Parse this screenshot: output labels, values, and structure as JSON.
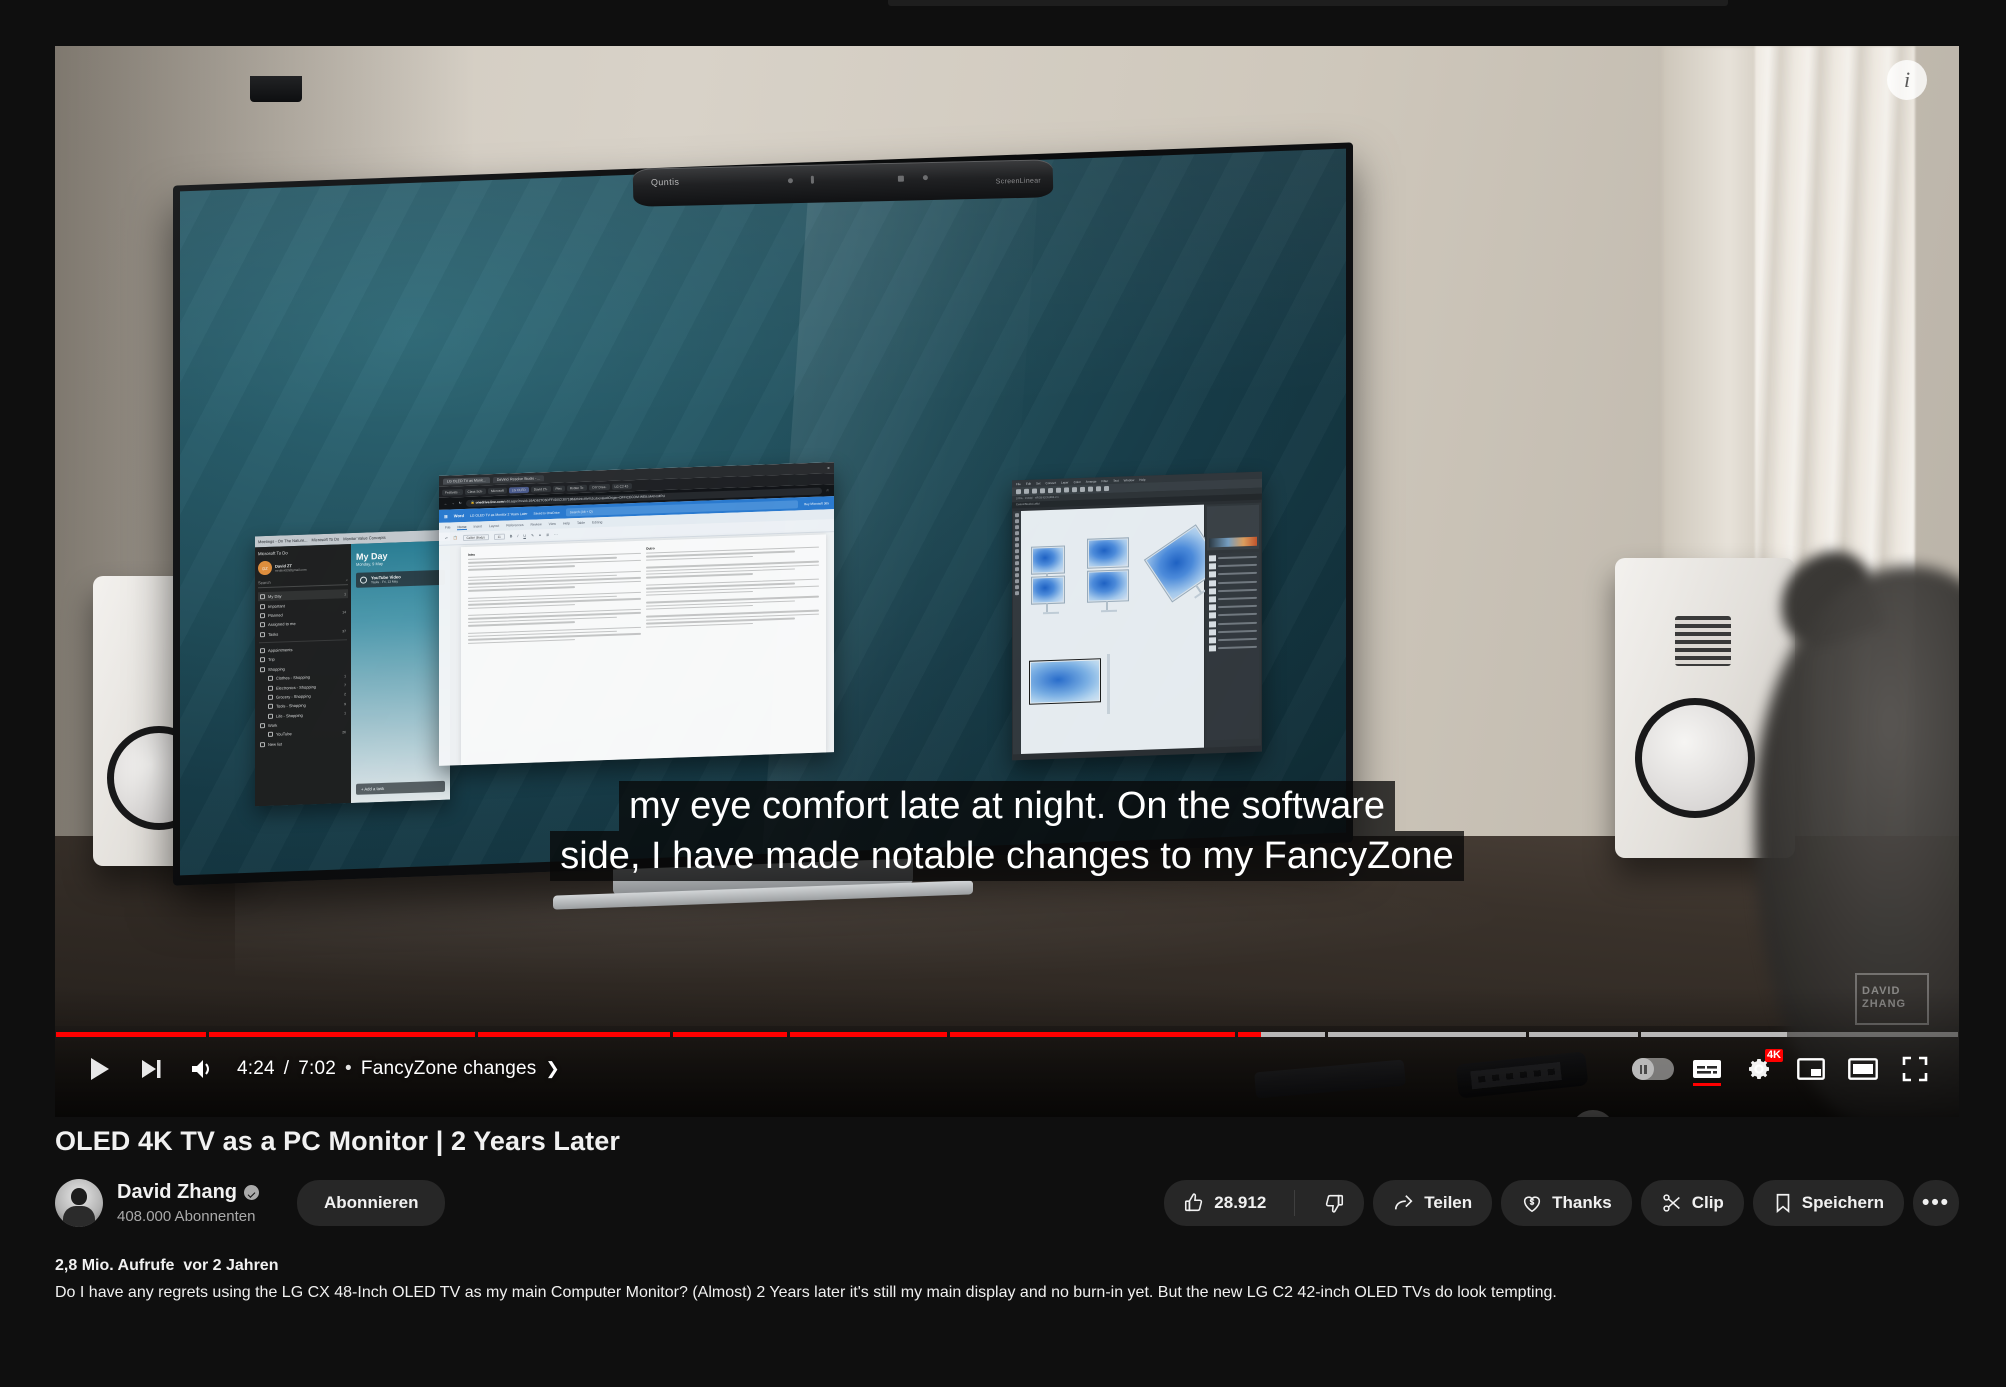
{
  "player": {
    "info_icon": "info-icon",
    "play_icon": "play-icon",
    "next_icon": "next-video-icon",
    "volume_icon": "volume-icon",
    "time_current": "4:24",
    "time_separator": "/",
    "time_total": "7:02",
    "chapter_bullet": "•",
    "chapter_name": "FancyZone changes",
    "chapter_chevron": "❯",
    "progress_percent": 62.8,
    "chapters": [
      {
        "width_pct": 8.0,
        "played_pct": 100
      },
      {
        "width_pct": 14.2,
        "played_pct": 100
      },
      {
        "width_pct": 10.2,
        "played_pct": 100
      },
      {
        "width_pct": 6.1,
        "played_pct": 100
      },
      {
        "width_pct": 8.4,
        "played_pct": 100
      },
      {
        "width_pct": 15.2,
        "played_pct": 100
      },
      {
        "width_pct": 4.6,
        "played_pct": 26,
        "loaded_pct": 100
      },
      {
        "width_pct": 10.6,
        "played_pct": 0,
        "loaded_pct": 100
      },
      {
        "width_pct": 5.8,
        "played_pct": 0,
        "loaded_pct": 100
      },
      {
        "width_pct": 16.9,
        "played_pct": 0,
        "loaded_pct": 46
      }
    ],
    "autoplay_toggle": {
      "state": "off",
      "knob_icon": "pause-icon"
    },
    "subtitles_icon": "subtitles-icon",
    "subtitles_active": true,
    "settings_icon": "gear-icon",
    "quality_badge": "4K",
    "miniplayer_icon": "miniplayer-icon",
    "theater_icon": "theater-mode-icon",
    "fullscreen_icon": "fullscreen-icon",
    "big_pause_icon": "pause-icon"
  },
  "captions": {
    "line1": "my eye comfort late at night. On the software",
    "line2": "side, I have made notable changes to my FancyZone"
  },
  "video": {
    "title": "OLED 4K TV as a PC Monitor | 2 Years Later",
    "watermark_line1": "DAVID",
    "watermark_line2": "ZHANG",
    "lightbar_brand": "Quntis",
    "lightbar_model": "ScreenLinear"
  },
  "channel": {
    "name": "David Zhang",
    "verified_icon": "verified-badge-icon",
    "subscribers": "408.000 Abonnenten",
    "subscribe_label": "Abonnieren",
    "avatar_name": "avatar"
  },
  "actions": {
    "like_icon": "thumbs-up-icon",
    "like_count": "28.912",
    "dislike_icon": "thumbs-down-icon",
    "share_icon": "share-icon",
    "share_label": "Teilen",
    "thanks_icon": "thanks-heart-dollar-icon",
    "thanks_label": "Thanks",
    "clip_icon": "scissors-icon",
    "clip_label": "Clip",
    "save_icon": "bookmark-icon",
    "save_label": "Speichern",
    "more_label": "•••"
  },
  "info": {
    "views": "2,8 Mio. Aufrufe",
    "published": "vor 2 Jahren",
    "description": "Do I have any regrets using the LG CX 48-Inch OLED TV as my main Computer Monitor? (Almost) 2 Years later it's still my main display and no burn-in yet. But the new LG C2 42-inch OLED TVs do look tempting."
  },
  "desktop": {
    "todo": {
      "tab1": "Meetings - On The Nature...",
      "tab2": "Microsoft To Do",
      "tab3": "Monitor Value Concepts",
      "brand": "Microsoft To Do",
      "avatar_initials": "DZ",
      "account_name": "David ZT",
      "account_mail": "mrdavidzt@gmail.com",
      "search_placeholder": "Search",
      "search_icon": "search-icon",
      "items": [
        {
          "label": "My Day",
          "count": "1",
          "selected": true
        },
        {
          "label": "Important",
          "count": ""
        },
        {
          "label": "Planned",
          "count": "14"
        },
        {
          "label": "Assigned to me",
          "count": ""
        },
        {
          "label": "Tasks",
          "count": "37"
        }
      ],
      "groups": [
        {
          "label": "Appointments",
          "count": "",
          "indent": false
        },
        {
          "label": "Trip",
          "count": "",
          "indent": false
        },
        {
          "label": "Shopping",
          "count": "",
          "indent": false
        },
        {
          "label": "Clothes - Shopping",
          "count": "1",
          "indent": true
        },
        {
          "label": "Electronics - Shopping",
          "count": "7",
          "indent": true
        },
        {
          "label": "Grocery - Shopping",
          "count": "2",
          "indent": true
        },
        {
          "label": "Tools - Shopping",
          "count": "9",
          "indent": true
        },
        {
          "label": "Life - Shopping",
          "count": "1",
          "indent": true
        },
        {
          "label": "Work",
          "count": "",
          "indent": false
        },
        {
          "label": "YouTube",
          "count": "26",
          "indent": true
        },
        {
          "label": "New list",
          "count": "",
          "indent": false
        }
      ],
      "myday_title": "My Day",
      "myday_date": "Monday, 9 May",
      "task_title": "YouTube Video",
      "task_sub": "Tasks  ·  Fri, 13 May",
      "add_task": "+  Add a task"
    },
    "word": {
      "win_tab1": "LG OLED TV as Monit...",
      "win_tab2": "DaVinci Resolve Studio - ...",
      "tabs": [
        "Festivals ·",
        "Class Sch·",
        "Microsoft",
        "LG OLED",
        "David Zh·",
        "Plex",
        "Rotten To·",
        "DIY Drea·",
        "LG C2 42·"
      ],
      "active_tab_index": 3,
      "url_domain": "onedrive.live.com",
      "url_path": "/edit.aspx?resid=16AD627C6DFF4D0C!307188&ithint=file%2cdocx&wdOrigin=OFFICECOM-WEB.MAIN.MRU",
      "app_name": "Word",
      "doc_name": "LG OLED TV as Monitor 2 Years Later",
      "save_state": "Saved to OneDrive",
      "search_placeholder": "Search (Alt + Q)",
      "buy_label": "Buy Microsoft 365",
      "share_label": "Share",
      "comments_label": "Comments",
      "ribbon_tabs": [
        "File",
        "Home",
        "Insert",
        "Layout",
        "References",
        "Review",
        "View",
        "Help",
        "Table",
        "Editing"
      ],
      "active_ribbon": "Home",
      "font_name": "Calibri (Body)",
      "font_size": "11",
      "doc_heading_left": "Intro",
      "doc_heading_right": "Outro"
    },
    "ps": {
      "menu": [
        "File",
        "Edit",
        "Set",
        "Convert",
        "Layer",
        "Color",
        "Arrange",
        "Filter",
        "Text",
        "Window",
        "Help"
      ],
      "tab_label": "CustomStudio1.afdd",
      "layer_count": 12
    }
  }
}
